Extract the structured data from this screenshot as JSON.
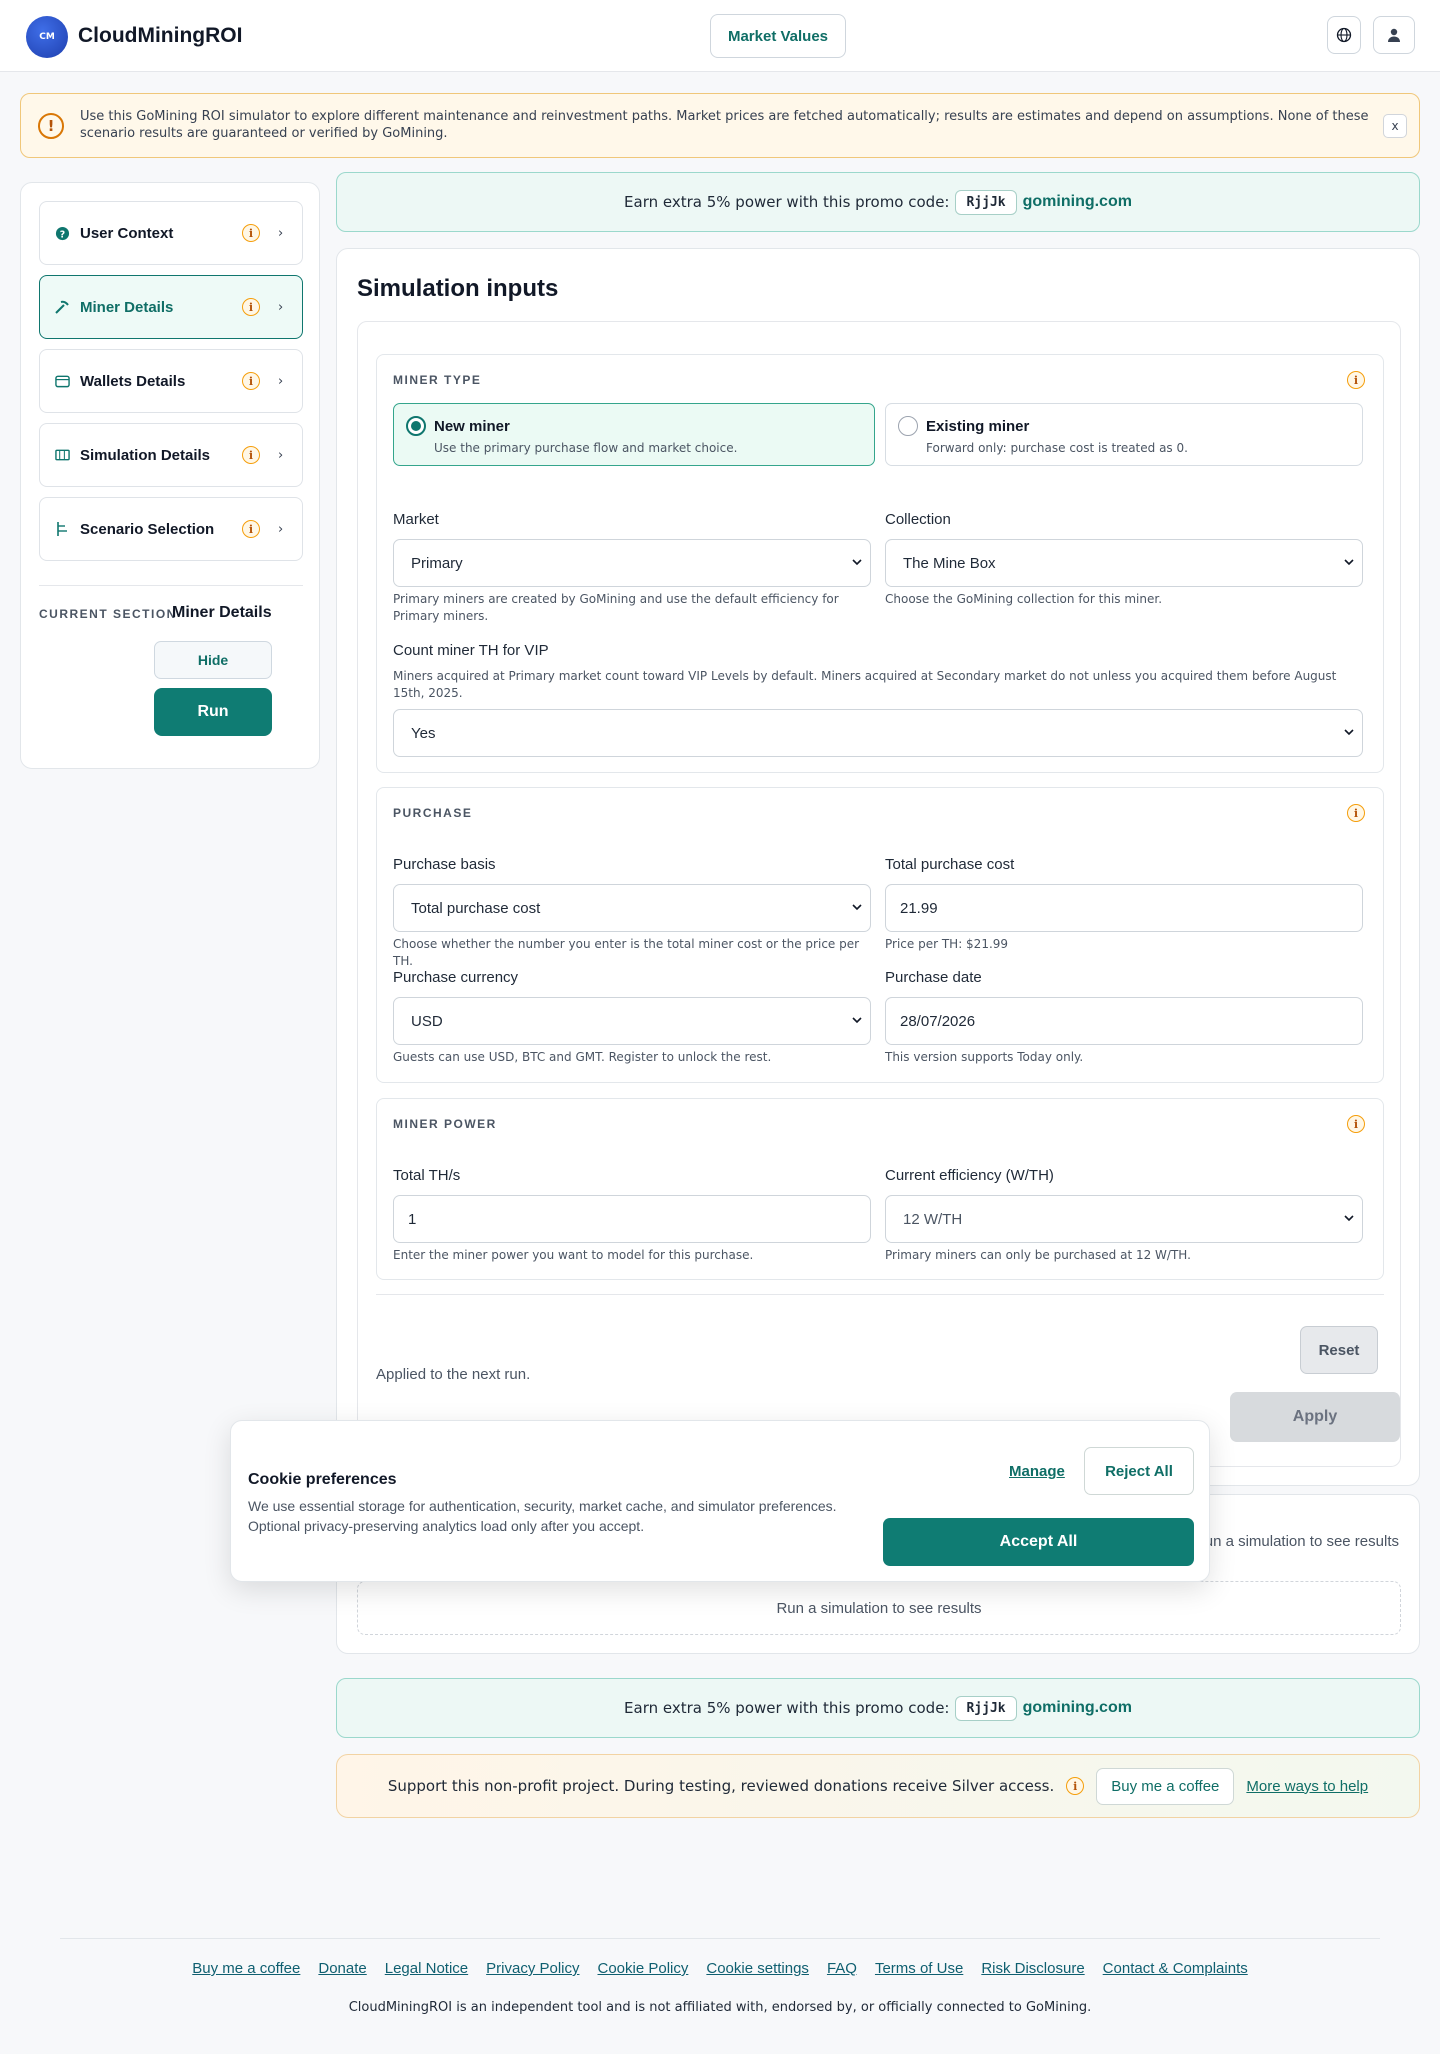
{
  "header": {
    "logo_text": "CM",
    "brand": "CloudMiningROI",
    "market_button": "Market Values"
  },
  "notice": {
    "icon_text": "!",
    "text": "Use this GoMining ROI simulator to explore different maintenance and reinvestment paths. Market prices are fetched automatically; results are estimates and depend on assumptions. None of these scenario results are guaranteed or verified by GoMining.",
    "close": "x"
  },
  "sidebar": {
    "items": [
      {
        "label": "User Context"
      },
      {
        "label": "Miner Details"
      },
      {
        "label": "Wallets Details"
      },
      {
        "label": "Simulation Details"
      },
      {
        "label": "Scenario Selection"
      }
    ],
    "info_glyph": "i",
    "chevron": "›",
    "current_section_label": "CURRENT SECTION",
    "current_section_value": "Miner Details",
    "hide": "Hide",
    "run": "Run"
  },
  "promo": {
    "text": "Earn extra 5% power with this promo code:",
    "code": "RjjJk",
    "site": "gomining.com"
  },
  "main": {
    "title": "Simulation inputs",
    "miner_type": {
      "heading": "MINER TYPE",
      "options": [
        {
          "title": "New miner",
          "sub": "Use the primary purchase flow and market choice."
        },
        {
          "title": "Existing miner",
          "sub": "Forward only: purchase cost is treated as 0."
        }
      ],
      "market_label": "Market",
      "market_value": "Primary",
      "market_help": "Primary miners are created by GoMining and use the default efficiency for Primary miners.",
      "collection_label": "Collection",
      "collection_value": "The Mine Box",
      "collection_help": "Choose the GoMining collection for this miner.",
      "vip_label": "Count miner TH for VIP",
      "vip_help": "Miners acquired at Primary market count toward VIP Levels by default. Miners acquired at Secondary market do not unless you acquired them before August 15th, 2025.",
      "vip_value": "Yes"
    },
    "purchase": {
      "heading": "PURCHASE",
      "basis_label": "Purchase basis",
      "basis_value": "Total purchase cost",
      "basis_help": "Choose whether the number you enter is the total miner cost or the price per TH.",
      "cost_label": "Total purchase cost",
      "cost_value": "21.99",
      "cost_help": "Price per TH: $21.99",
      "currency_label": "Purchase currency",
      "currency_value": "USD",
      "currency_help": "Guests can use USD, BTC and GMT. Register to unlock the rest.",
      "date_label": "Purchase date",
      "date_value": "28/07/2026",
      "date_help": "This version supports Today only."
    },
    "power": {
      "heading": "MINER POWER",
      "ths_label": "Total TH/s",
      "ths_value": "1",
      "ths_help": "Enter the miner power you want to model for this purchase.",
      "eff_label": "Current efficiency (W/TH)",
      "eff_value": "12 W/TH",
      "eff_help": "Primary miners can only be purchased at 12 W/TH."
    },
    "reset": "Reset",
    "applied": "Applied to the next run.",
    "apply": "Apply"
  },
  "results": {
    "side_text": "Run a simulation to see results",
    "box_text": "Run a simulation to see results"
  },
  "support": {
    "text": "Support this non-profit project. During testing, reviewed donations receive Silver access.",
    "coffee": "Buy me a coffee",
    "more": "More ways to help"
  },
  "cookie": {
    "title": "Cookie preferences",
    "text": "We use essential storage for authentication, security, market cache, and simulator preferences. Optional privacy-preserving analytics load only after you accept.",
    "manage": "Manage",
    "reject": "Reject All",
    "accept": "Accept All"
  },
  "footer": {
    "links": [
      "Buy me a coffee",
      "Donate",
      "Legal Notice",
      "Privacy Policy",
      "Cookie Policy",
      "Cookie settings",
      "FAQ",
      "Terms of Use",
      "Risk Disclosure",
      "Contact & Complaints"
    ],
    "note": "CloudMiningROI is an independent tool and is not affiliated with, endorsed by, or officially connected to GoMining."
  },
  "colors": {
    "brand_teal": "#0f7c73",
    "accent_amber": "#f59e0b",
    "notice_bg": "#fff8ea"
  },
  "icons": {
    "header": [
      "globe-icon",
      "user-icon"
    ],
    "sidebar": [
      "user-context-icon",
      "miner-icon",
      "wallet-icon",
      "simulation-icon",
      "scenario-icon"
    ]
  }
}
